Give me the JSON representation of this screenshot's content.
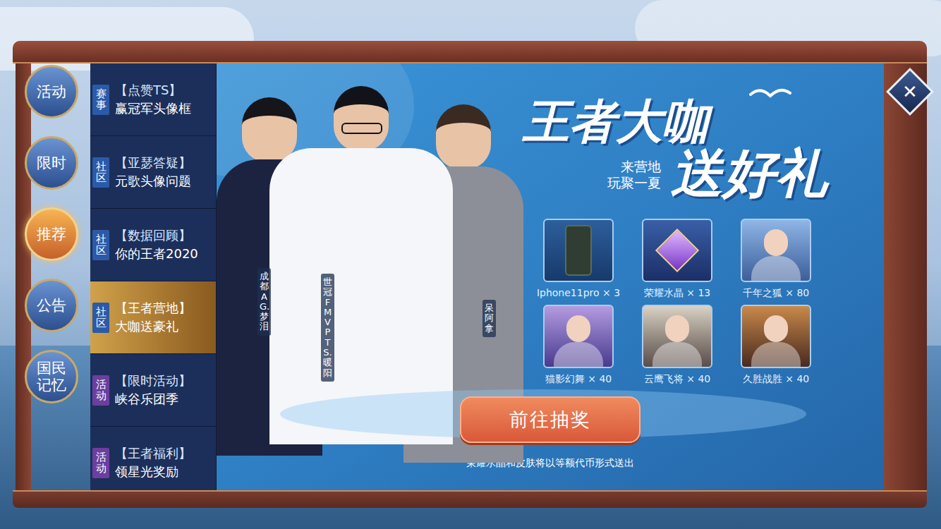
{
  "close": "✕",
  "categories": [
    {
      "label": "活动",
      "selected": false
    },
    {
      "label": "限时",
      "selected": false
    },
    {
      "label": "推荐",
      "selected": true
    },
    {
      "label": "公告",
      "selected": false
    },
    {
      "label": "国民记忆",
      "selected": false
    }
  ],
  "sidebar": {
    "items": [
      {
        "tag": "赛事",
        "title": "【点赞TS】",
        "subtitle": "赢冠军头像框",
        "selected": false,
        "color": "#2b5aa8"
      },
      {
        "tag": "社区",
        "title": "【亚瑟答疑】",
        "subtitle": "元歌头像问题",
        "selected": false,
        "color": "#2b5aa8"
      },
      {
        "tag": "社区",
        "title": "【数据回顾】",
        "subtitle": "你的王者2020",
        "selected": false,
        "color": "#2b5aa8"
      },
      {
        "tag": "社区",
        "title": "【王者营地】",
        "subtitle": "大咖送豪礼",
        "selected": true,
        "color": "#2b5aa8"
      },
      {
        "tag": "活动",
        "title": "【限时活动】",
        "subtitle": "峡谷乐团季",
        "selected": false,
        "color": "#6b3fa0"
      },
      {
        "tag": "活动",
        "title": "【王者福利】",
        "subtitle": "领星光奖励",
        "selected": false,
        "color": "#6b3fa0"
      }
    ]
  },
  "banner": {
    "title_line1": "王者大咖",
    "title_line2": "送好礼",
    "slogan_line1": "来营地",
    "slogan_line2": "玩聚一夏",
    "people": [
      {
        "label": "成都 AG.梦泪"
      },
      {
        "label": "世冠 FMVP TS.暖阳"
      },
      {
        "label": "呆阿拿"
      }
    ],
    "prizes": [
      {
        "label": "Iphone11pro × 3"
      },
      {
        "label": "荣耀水晶 × 13"
      },
      {
        "label": "千年之狐 × 80"
      },
      {
        "label": "猫影幻舞 × 40"
      },
      {
        "label": "云鹰飞将 × 40"
      },
      {
        "label": "久胜战胜 × 40"
      }
    ],
    "button": "前往抽奖",
    "note": "荣耀水晶和皮肤将以等额代币形式送出"
  }
}
